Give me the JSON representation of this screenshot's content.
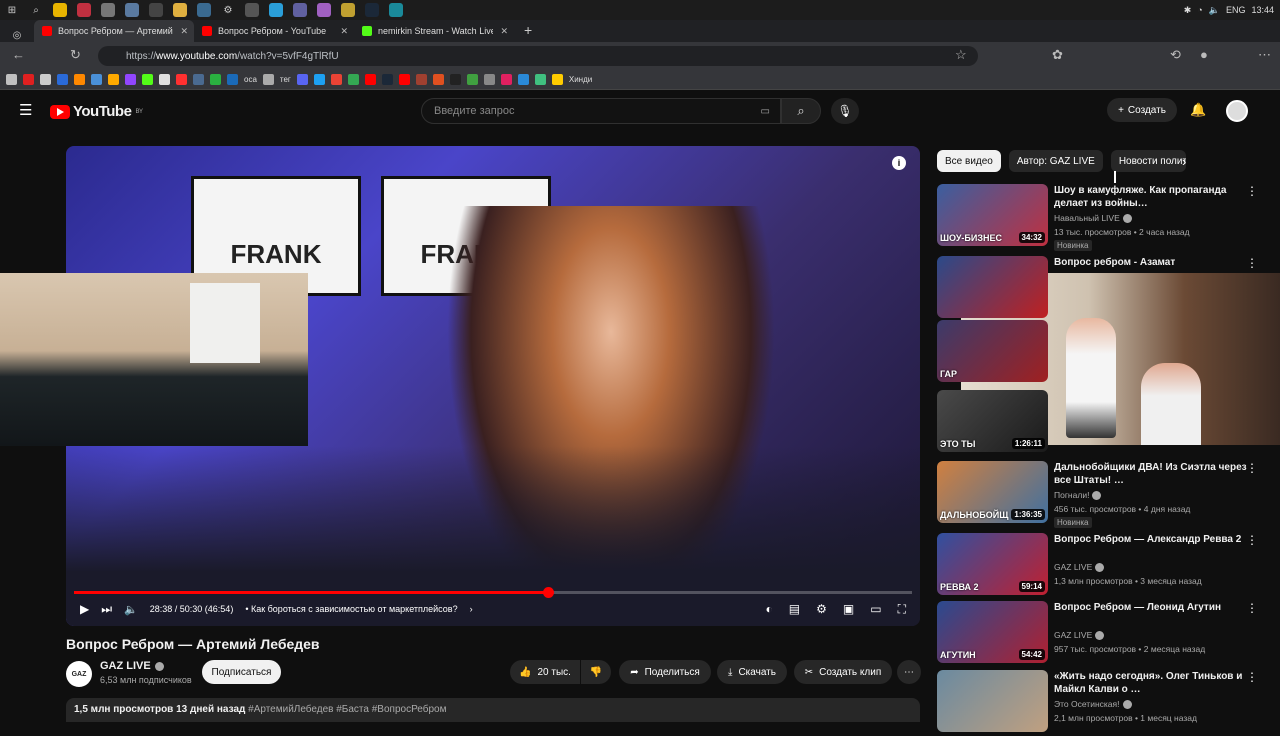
{
  "os": {
    "time": "13:44",
    "lang": "ENG"
  },
  "tabs": [
    {
      "label": "Вопрос Ребром — Артемий Лебедев",
      "favicon_color": "#ff0000",
      "active": true
    },
    {
      "label": "Вопрос Ребром - YouTube",
      "favicon_color": "#ff0000",
      "active": false
    },
    {
      "label": "nemirkin Stream - Watch Live on Kick",
      "favicon_color": "#53fc18",
      "active": false
    }
  ],
  "address": {
    "host": "www.youtube.com",
    "path": "/watch?v=5vfF4gTlRfU",
    "prefix": "https://"
  },
  "bookmarks": {
    "items": [
      "оса",
      "тег",
      "Хинди"
    ]
  },
  "header": {
    "logo": "YouTube",
    "region": "BY",
    "search_placeholder": "Введите запрос",
    "create_label": "Создать"
  },
  "player": {
    "screen_text": "FRANK",
    "time": "28:38 / 50:30 (46:54)",
    "chapter": "• Как бороться с зависимостью от маркетплейсов?",
    "progress": 0.566
  },
  "video": {
    "title": "Вопрос Ребром — Артемий Лебедев",
    "channel": "GAZ LIVE",
    "channel_logo": "GAZ",
    "subscribers": "6,53 млн подписчиков",
    "subscribe_label": "Подписаться",
    "likes": "20 тыс.",
    "share_label": "Поделиться",
    "download_label": "Скачать",
    "clip_label": "Создать клип",
    "views_date": "1,5 млн просмотров  13 дней назад",
    "tags": "#АртемийЛебедев #Баста #ВопросРебром"
  },
  "chips": [
    "Все видео",
    "Автор: GAZ LIVE",
    "Новости полит"
  ],
  "recommendations": [
    {
      "title": "Шоу в камуфляже. Как пропаганда делает из войны…",
      "channel": "Навальный LIVE",
      "meta": "13 тыс. просмотров • 2 часа назад",
      "badge": "Новинка",
      "duration": "34:32",
      "thumb_text": "ШОУ-БИЗНЕС",
      "color1": "#3a5fa0",
      "color2": "#c03040"
    },
    {
      "title": "Вопрос ребром - Азамат",
      "channel": "",
      "meta": "",
      "badge": "",
      "duration": "",
      "thumb_text": "",
      "color1": "#2a4a8a",
      "color2": "#c02020"
    },
    {
      "title": "",
      "channel": "",
      "meta": "",
      "badge": "",
      "duration": "",
      "thumb_text": "ГАР",
      "color1": "#3b3b6b",
      "color2": "#a02020"
    },
    {
      "title": "",
      "channel": "",
      "meta": "",
      "badge": "",
      "duration": "1:26:11",
      "thumb_text": "ЭТО ТЫ",
      "color1": "#4a4a4a",
      "color2": "#1a1a1a"
    },
    {
      "title": "Дальнобойщики ДВА! Из Сиэтла через все Штаты! …",
      "channel": "Погнали!",
      "meta": "456 тыс. просмотров • 4 дня назад",
      "badge": "Новинка",
      "duration": "1:36:35",
      "thumb_text": "ДАЛЬНОБОЙЩ",
      "color1": "#d08040",
      "color2": "#4070a0"
    },
    {
      "title": "Вопрос Ребром — Александр Ревва 2",
      "channel": "GAZ LIVE",
      "meta": "1,3 млн просмотров • 3 месяца назад",
      "badge": "",
      "duration": "59:14",
      "thumb_text": "РЕВВА 2",
      "color1": "#3050a0",
      "color2": "#c02030"
    },
    {
      "title": "Вопрос Ребром — Леонид Агутин",
      "channel": "GAZ LIVE",
      "meta": "957 тыс. просмотров • 2 месяца назад",
      "badge": "",
      "duration": "54:42",
      "thumb_text": "АГУТИН",
      "color1": "#2a4a90",
      "color2": "#b02030"
    },
    {
      "title": "«Жить надо сегодня». Олег Тиньков и Майкл Калви о …",
      "channel": "Это Осетинская!",
      "meta": "2,1 млн просмотров • 1 месяц назад",
      "badge": "",
      "duration": "",
      "thumb_text": "",
      "color1": "#6a8aa0",
      "color2": "#c0a080"
    }
  ]
}
